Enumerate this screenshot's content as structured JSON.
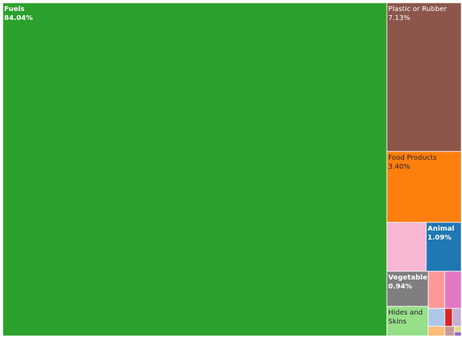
{
  "chart_data": {
    "type": "treemap",
    "title": "",
    "items": [
      {
        "label": "Fuels",
        "value": 84.04,
        "value_text": "84.04%",
        "color": "#2ca02c",
        "label_color": "#ffffff",
        "bold": true
      },
      {
        "label": "Plastic or Rubber",
        "value": 7.13,
        "value_text": "7.13%",
        "color": "#8c564b",
        "label_color": "#ffffff",
        "bold": false
      },
      {
        "label": "Food Products",
        "value": 3.4,
        "value_text": "3.40%",
        "color": "#ff7f0e",
        "label_color": "#222222",
        "bold": false
      },
      {
        "label": "",
        "value": 1.24,
        "value_text": "",
        "color": "#f7b6d2"
      },
      {
        "label": "Animal",
        "value": 1.09,
        "value_text": "1.09%",
        "color": "#1f77b4",
        "label_color": "#ffffff",
        "bold": true
      },
      {
        "label": "Vegetable",
        "value": 0.94,
        "value_text": "0.94%",
        "color": "#7f7f7f",
        "label_color": "#ffffff",
        "bold": true
      },
      {
        "label": "Hides and Skins",
        "value": 0.74,
        "value_text": "",
        "color": "#98df8a",
        "label_color": "#222222",
        "bold": false
      },
      {
        "label": "",
        "value": 0.4,
        "value_text": "",
        "color": "#ff9896"
      },
      {
        "label": "",
        "value": 0.4,
        "value_text": "",
        "color": "#e377c2"
      },
      {
        "label": "",
        "value": 0.18,
        "value_text": "",
        "color": "#aec7e8"
      },
      {
        "label": "",
        "value": 0.09,
        "value_text": "",
        "color": "#d62728"
      },
      {
        "label": "",
        "value": 0.11,
        "value_text": "",
        "color": "#c5b0d5"
      },
      {
        "label": "",
        "value": 0.1,
        "value_text": "",
        "color": "#ffbb78"
      },
      {
        "label": "",
        "value": 0.07,
        "value_text": "",
        "color": "#c49c94"
      },
      {
        "label": "",
        "value": 0.02,
        "value_text": "",
        "color": "#dbdb8d"
      },
      {
        "label": "",
        "value": 0.02,
        "value_text": "",
        "color": "#9467bd"
      }
    ]
  }
}
